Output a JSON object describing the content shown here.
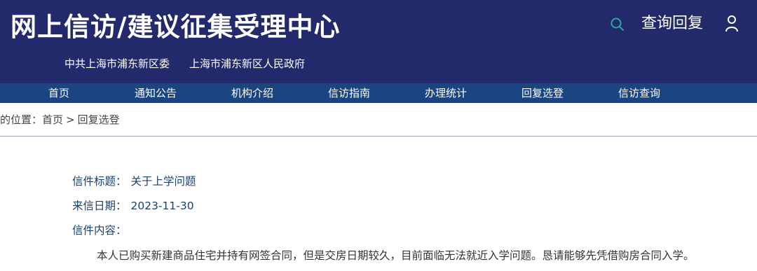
{
  "header": {
    "site_title": "网上信访/建议征集受理中心",
    "sub_links": [
      "中共上海市浦东新区委",
      "上海市浦东新区人民政府"
    ],
    "query_reply": "查询回复",
    "search_icon": "search-icon",
    "user_icon": "user-icon"
  },
  "nav": {
    "items": [
      "首页",
      "通知公告",
      "机构介绍",
      "信访指南",
      "办理统计",
      "回复选登",
      "信访查询"
    ]
  },
  "breadcrumb": {
    "prefix": "的位置：",
    "home": "首页",
    "separator": ">",
    "current": "回复选登"
  },
  "letter": {
    "title_label": "信件标题：",
    "title_value": "关于上学问题",
    "date_label": "来信日期：",
    "date_value": "2023-11-30",
    "content_label": "信件内容：",
    "content_value": "本人已购买新建商品住宅并持有网签合同，但是交房日期较久，目前面临无法就近入学问题。恳请能够先凭借购房合同入学。"
  },
  "colors": {
    "header_bg": "#232a6c",
    "nav_bg": "#1a4580",
    "search_icon": "#2aa89a",
    "text_blue": "#1b3f6e"
  }
}
